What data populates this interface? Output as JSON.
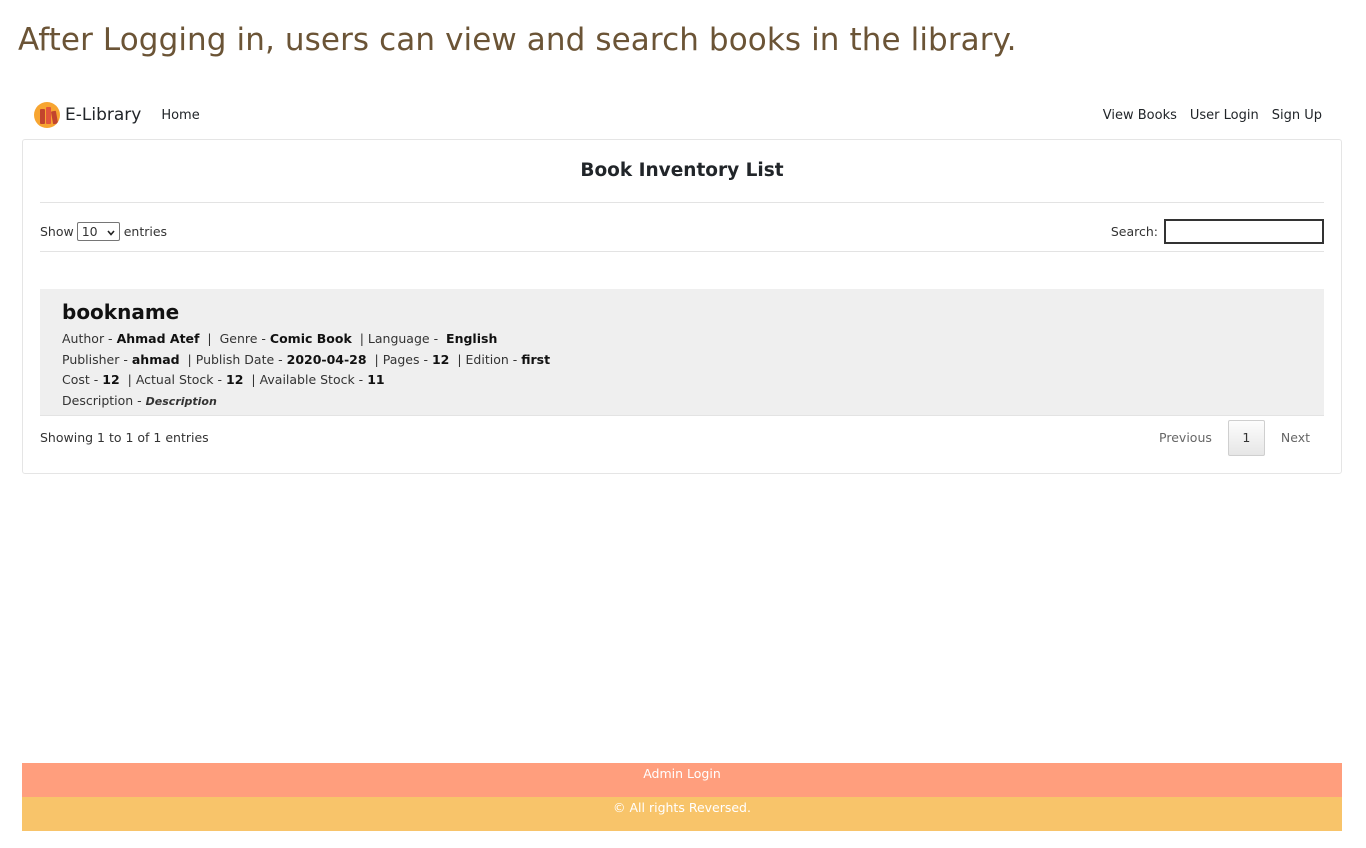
{
  "caption": "After Logging in, users can view and search books in the library.",
  "navbar": {
    "brand": "E-Library",
    "home": "Home",
    "right_links": [
      "View Books",
      "User Login",
      "Sign Up"
    ]
  },
  "card": {
    "title": "Book Inventory List",
    "show_label": "Show",
    "entries_value": "10",
    "entries_label": "entries",
    "search_label": "Search:",
    "search_value": ""
  },
  "book": {
    "name": "bookname",
    "author_label": "Author -",
    "author": "Ahmad Atef",
    "genre_label": "Genre -",
    "genre": "Comic Book",
    "language_label": "Language -",
    "language": "English",
    "publisher_label": "Publisher -",
    "publisher": "ahmad",
    "publish_date_label": "Publish Date -",
    "publish_date": "2020-04-28",
    "pages_label": "Pages -",
    "pages": "12",
    "edition_label": "Edition -",
    "edition": "first",
    "cost_label": "Cost -",
    "cost": "12",
    "actual_stock_label": "Actual Stock -",
    "actual_stock": "12",
    "available_stock_label": "Available Stock -",
    "available_stock": "11",
    "description_label": "Description -",
    "description": "Description"
  },
  "table_footer": {
    "info": "Showing 1 to 1 of 1 entries",
    "previous": "Previous",
    "page": "1",
    "next": "Next"
  },
  "footer": {
    "admin_login": "Admin Login",
    "copyright": "© All rights Reversed."
  },
  "colors": {
    "caption": "#6b5436",
    "footer_top": "#ff9e7d",
    "footer_bottom": "#f8c46a",
    "row_background": "#efefef"
  }
}
